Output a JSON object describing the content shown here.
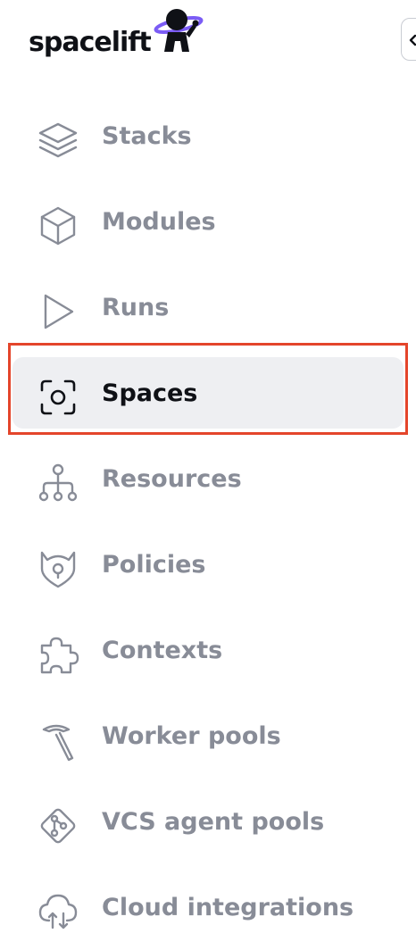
{
  "brand": {
    "name": "spacelift"
  },
  "colors": {
    "text_muted": "#888c97",
    "text_active": "#0f1116",
    "active_bg": "#eeeff2",
    "highlight": "#e4452b",
    "logo_accent": "#7b5cf5"
  },
  "nav": {
    "items": [
      {
        "label": "Stacks",
        "icon": "layers-icon"
      },
      {
        "label": "Modules",
        "icon": "cube-icon"
      },
      {
        "label": "Runs",
        "icon": "play-icon"
      },
      {
        "label": "Spaces",
        "icon": "spaces-icon",
        "active": true
      },
      {
        "label": "Resources",
        "icon": "resources-icon"
      },
      {
        "label": "Policies",
        "icon": "policies-icon"
      },
      {
        "label": "Contexts",
        "icon": "puzzle-icon"
      },
      {
        "label": "Worker pools",
        "icon": "pickaxe-icon"
      },
      {
        "label": "VCS agent pools",
        "icon": "vcs-icon"
      },
      {
        "label": "Cloud integrations",
        "icon": "cloud-icon"
      }
    ]
  }
}
